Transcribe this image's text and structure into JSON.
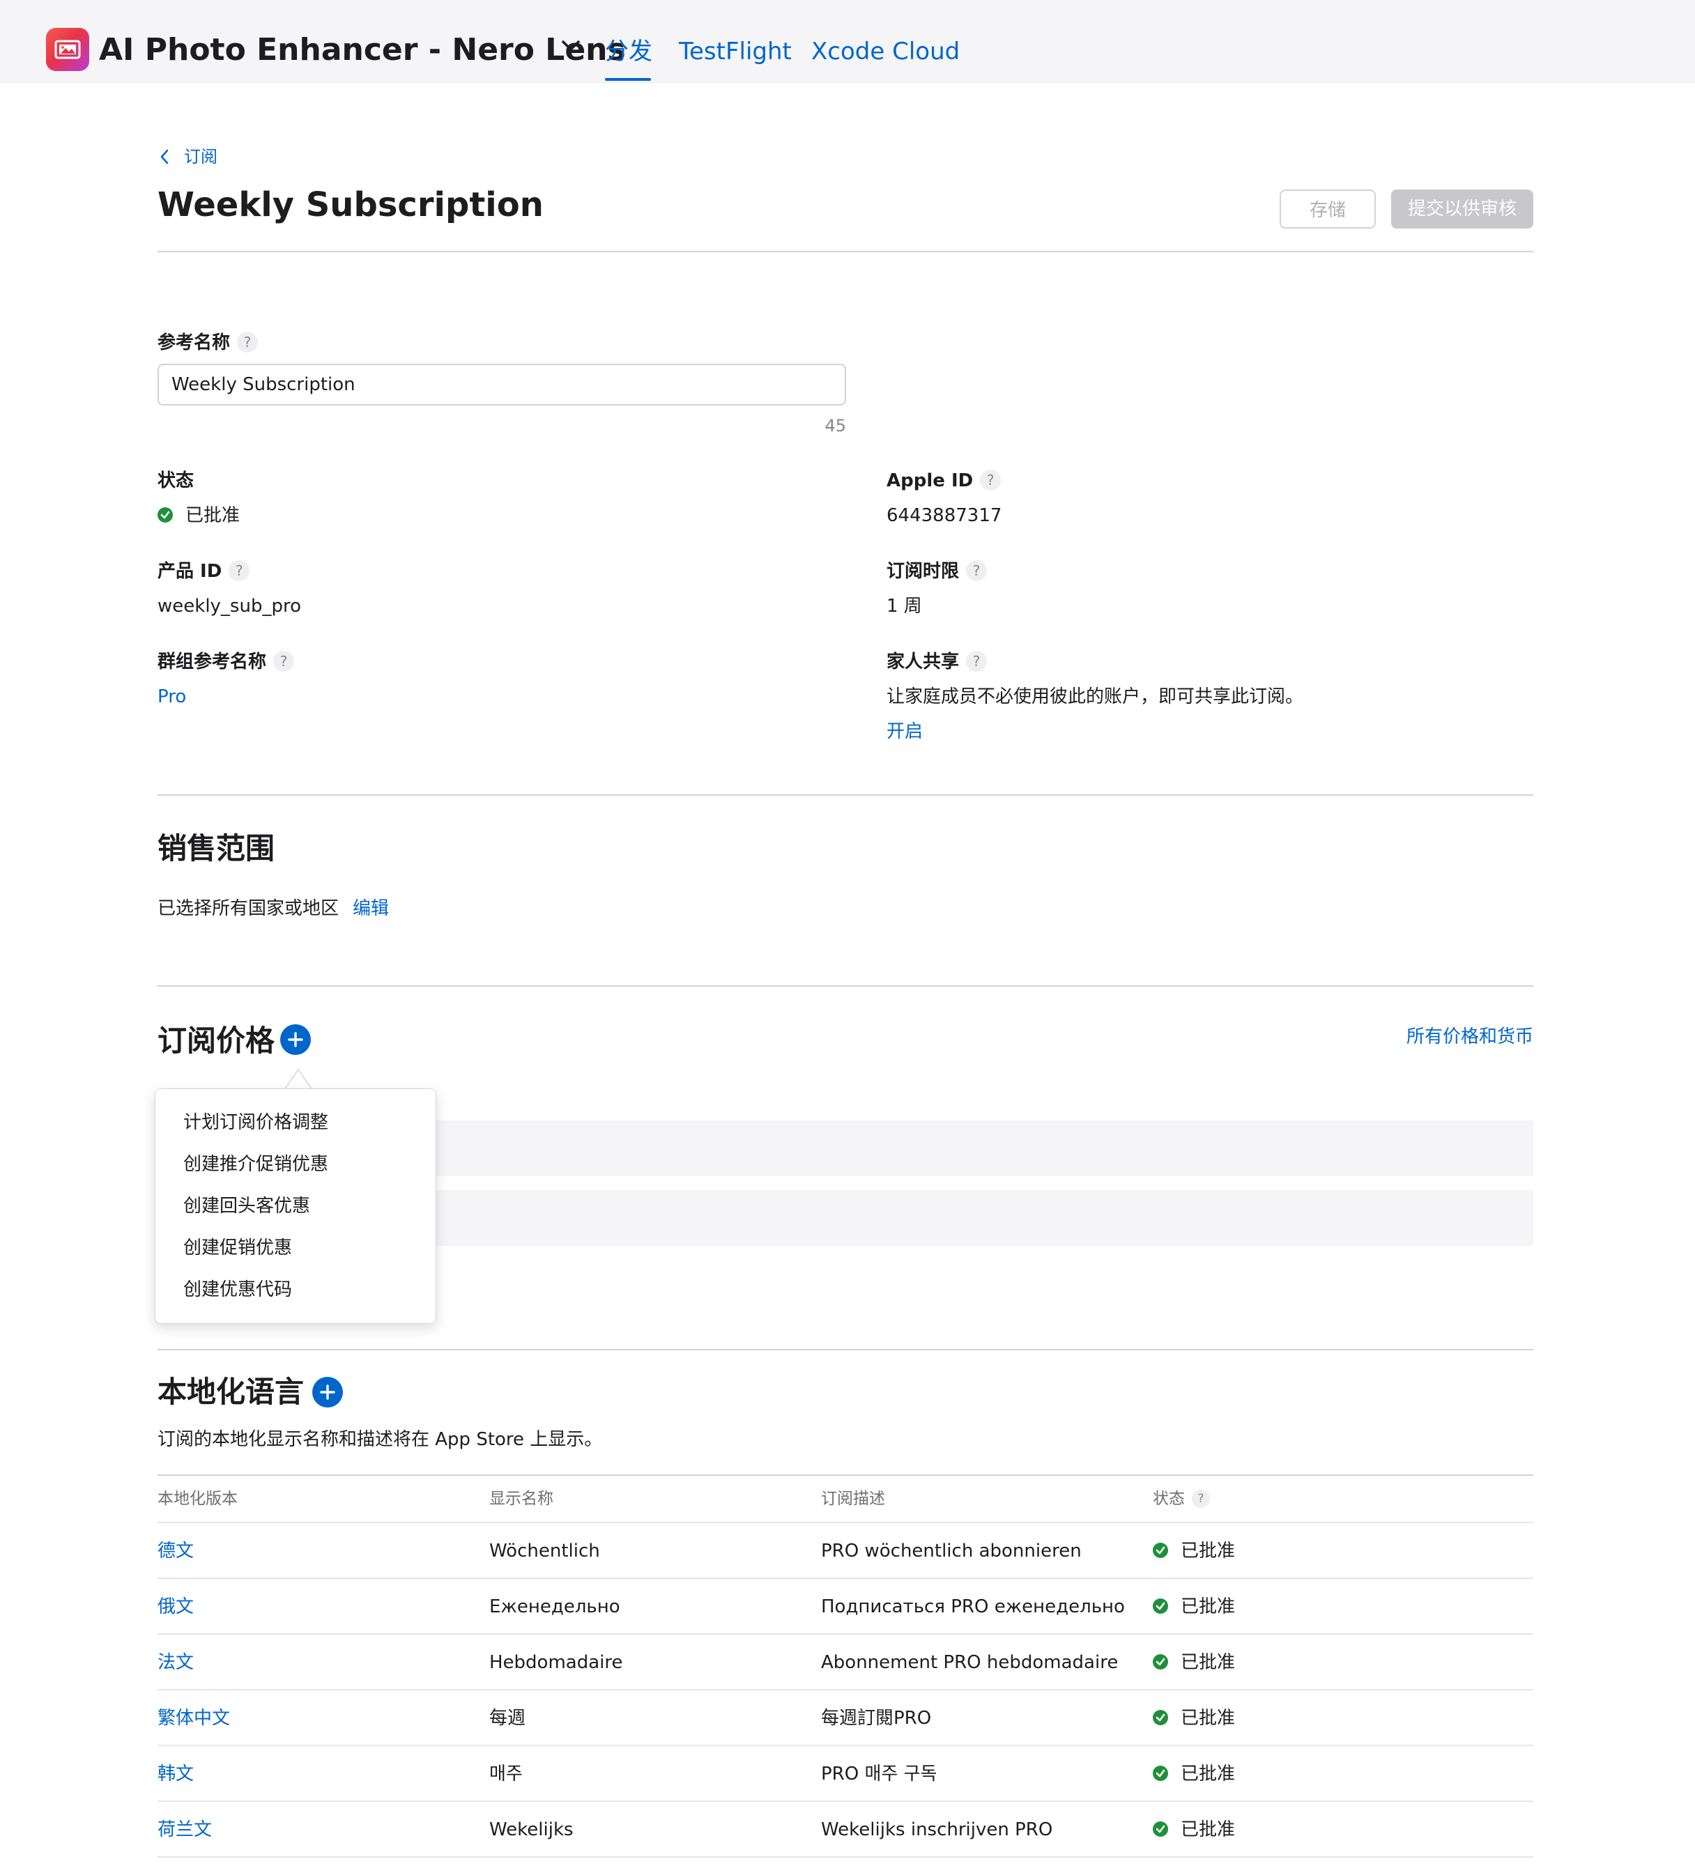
{
  "app": {
    "title": "AI Photo Enhancer - Nero Lens",
    "icon": "photo-icon",
    "brand_colors": [
      "#f55a4e",
      "#b83ad8"
    ]
  },
  "nav": {
    "tabs": [
      {
        "label": "分发",
        "active": true
      },
      {
        "label": "TestFlight",
        "active": false
      },
      {
        "label": "Xcode Cloud",
        "active": false
      }
    ],
    "accent": "#0066cc"
  },
  "breadcrumb": {
    "back_label": "订阅"
  },
  "page": {
    "title": "Weekly Subscription",
    "save_label": "存储",
    "submit_label": "提交以供审核"
  },
  "fields": {
    "reference_name": {
      "label": "参考名称",
      "value": "Weekly Subscription",
      "remaining": "45"
    },
    "status": {
      "label": "状态",
      "value": "已批准"
    },
    "product_id": {
      "label": "产品 ID",
      "value": "weekly_sub_pro"
    },
    "group_reference": {
      "label": "群组参考名称",
      "value": "Pro"
    },
    "apple_id": {
      "label": "Apple ID",
      "value": "6443887317"
    },
    "duration": {
      "label": "订阅时限",
      "value": "1 周"
    },
    "family_sharing": {
      "label": "家人共享",
      "description": "让家庭成员不必使用彼此的账户，即可共享此订阅。",
      "action": "开启"
    }
  },
  "availability": {
    "title": "销售范围",
    "summary": "已选择所有国家或地区",
    "edit_label": "编辑"
  },
  "pricing": {
    "title": "订阅价格",
    "all_prices_link": "所有价格和货币",
    "menu": [
      "计划订阅价格调整",
      "创建推介促销优惠",
      "创建回头客优惠",
      "创建促销优惠",
      "创建优惠代码"
    ]
  },
  "localization": {
    "title": "本地化语言",
    "description": "订阅的本地化显示名称和描述将在 App Store 上显示。",
    "columns": [
      "本地化版本",
      "显示名称",
      "订阅描述",
      "状态"
    ],
    "rows": [
      {
        "locale": "德文",
        "name": "Wöchentlich",
        "desc": "PRO wöchentlich abonnieren",
        "status": "已批准"
      },
      {
        "locale": "俄文",
        "name": "Еженедельно",
        "desc": "Подписаться PRO еженедельно",
        "status": "已批准"
      },
      {
        "locale": "法文",
        "name": "Hebdomadaire",
        "desc": "Abonnement PRO hebdomadaire",
        "status": "已批准"
      },
      {
        "locale": "繁体中文",
        "name": "每週",
        "desc": "每週訂閱PRO",
        "status": "已批准"
      },
      {
        "locale": "韩文",
        "name": "매주",
        "desc": "PRO 매주 구독",
        "status": "已批准"
      },
      {
        "locale": "荷兰文",
        "name": "Wekelijks",
        "desc": "Wekelijks inschrijven PRO",
        "status": "已批准"
      }
    ]
  }
}
